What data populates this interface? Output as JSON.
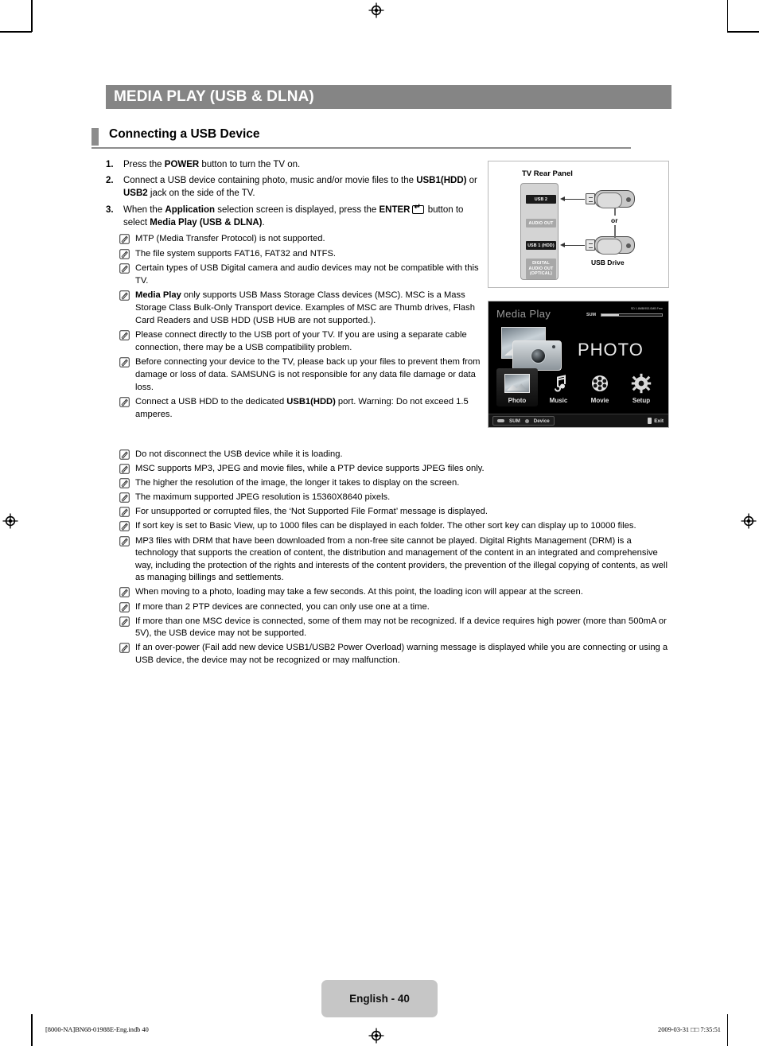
{
  "document": {
    "title": "MEDIA PLAY (USB & DLNA)",
    "section_heading": "Connecting a USB Device",
    "page_label": "English - 40",
    "print_job": "[8000-NA]BN68-01988E-Eng.indb   40",
    "print_timestamp": "2009-03-31   □□ 7:35:51"
  },
  "steps": [
    {
      "num": "1.",
      "html": "Press the <b>POWER</b> button to turn the TV on."
    },
    {
      "num": "2.",
      "html": "Connect a USB device containing photo, music and/or movie files to the <b>USB1(HDD)</b> or <b>USB2</b> jack on the side of the TV."
    },
    {
      "num": "3.",
      "html": "When the <b>Application</b> selection screen is displayed, press the <b>ENTER</b><span class=\"key-enter\" data-name=\"enter-key-icon\" data-interactable=\"false\"></span> button to select <b>Media Play (USB &amp; DLNA)</b>."
    }
  ],
  "notes_narrow": [
    {
      "html": "MTP (Media Transfer Protocol) is not supported."
    },
    {
      "html": "The file system supports FAT16, FAT32 and NTFS."
    },
    {
      "html": "Certain types of USB Digital camera and audio devices may not be compatible with this TV."
    },
    {
      "html": "<b>Media Play</b> only supports USB Mass Storage Class devices (MSC). MSC is a Mass Storage Class Bulk-Only Transport device. Examples of MSC are Thumb drives, Flash Card Readers and USB HDD (USB HUB are not supported.)."
    },
    {
      "html": "Please connect directly to the USB port of your TV. If you are using a separate cable connection, there may be a USB compatibility problem."
    },
    {
      "html": "Before connecting your device to the TV, please back up your files to prevent them from damage or loss of data. SAMSUNG is not responsible for any data file damage or data loss."
    },
    {
      "html": "Connect a USB HDD to the dedicated <b>USB1(HDD)</b> port. Warning: Do not exceed 1.5 amperes."
    }
  ],
  "notes_wide": [
    {
      "html": "Do not disconnect the USB device while it is loading."
    },
    {
      "html": "MSC supports MP3, JPEG and movie files, while a PTP device supports JPEG files only."
    },
    {
      "html": "The higher the resolution of the image, the longer it takes to display on the screen."
    },
    {
      "html": "The maximum supported JPEG resolution is 15360X8640 pixels."
    },
    {
      "html": "For unsupported or corrupted files, the ‘Not Supported File Format’ message is displayed."
    },
    {
      "html": "If sort key is set to Basic View, up to 1000 files can be displayed in each folder. The other sort key can display up to 10000 files."
    },
    {
      "html": "MP3 files with DRM that have been downloaded from a non-free site cannot be played. Digital Rights Management (DRM) is a technology that supports the creation of content, the distribution and management of the content in an integrated and comprehensive way, including the protection of the rights and interests of the content providers, the prevention of the illegal copying of contents, as well as managing billings and settlements."
    },
    {
      "html": "When moving to a photo, loading may take a few seconds. At this point, the loading icon will appear at the screen."
    },
    {
      "html": "If more than 2 PTP devices are connected, you can only use one at a time."
    },
    {
      "html": "If more than one MSC device is connected, some of them may not be recognized. If a device requires high power (more than 500mA or 5V), the USB device may not be supported."
    },
    {
      "html": "If an over-power (Fail add new device USB1/USB2 Power Overload) warning message is displayed while you are connecting or using a USB device, the device may not be recognized or may malfunction."
    }
  ],
  "figure_panel": {
    "caption": "TV Rear Panel",
    "ports": [
      {
        "label": "USB 2",
        "style": "dark"
      },
      {
        "label": "AUDIO OUT",
        "style": "light"
      },
      {
        "label": "USB 1 (HDD)",
        "style": "dark"
      },
      {
        "label": "DIGITAL AUDIO OUT (OPTICAL)",
        "style": "light"
      }
    ],
    "or_label": "or",
    "drive_label": "USB Drive"
  },
  "figure_osd": {
    "title": "Media Play",
    "hero_label": "PHOTO",
    "meter_caption": "SD 1.8MB/953.0MB Free",
    "meter_source": "SUM",
    "items": [
      {
        "label": "Photo",
        "icon": "photo-icon",
        "selected": true
      },
      {
        "label": "Music",
        "icon": "music-note-icon",
        "selected": false
      },
      {
        "label": "Movie",
        "icon": "film-reel-icon",
        "selected": false
      },
      {
        "label": "Setup",
        "icon": "gear-icon",
        "selected": false
      }
    ],
    "footer_source": "SUM",
    "footer_device": "Device",
    "footer_exit": "Exit"
  },
  "colors": {
    "title_bar": "#858585",
    "accent": "#8c8c8c",
    "page_box": "#c6c6c6"
  }
}
